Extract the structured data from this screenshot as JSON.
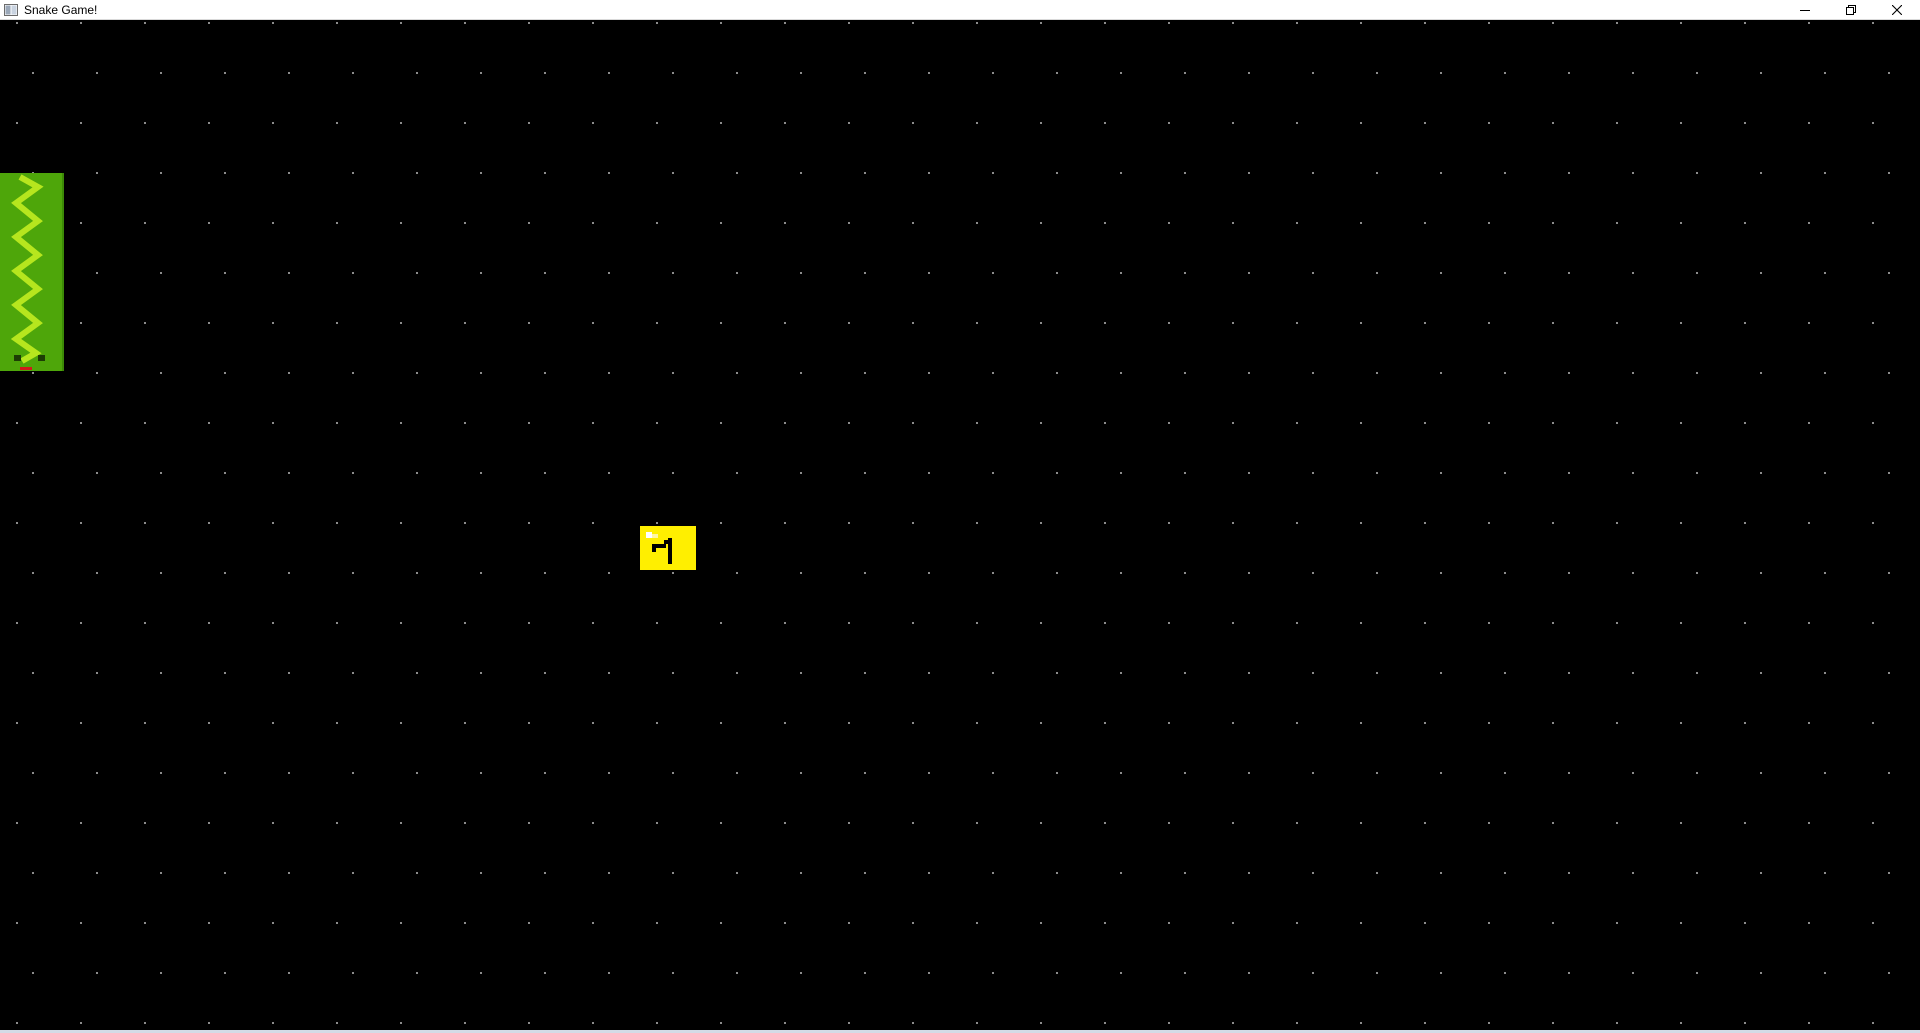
{
  "window": {
    "title": "Snake Game!",
    "icon": "app-window-icon",
    "controls": {
      "minimize_icon": "minimize-icon",
      "maximize_icon": "restore-icon",
      "close_icon": "close-icon"
    }
  },
  "game": {
    "background_color": "#000000",
    "grid_dot_color": "#8c8c8c",
    "snake": {
      "body_color": "#4ea60a",
      "stripe_color": "#b6e61e",
      "eye_color": "#1d3d05",
      "tongue_color": "#d11a1a"
    },
    "food": {
      "color": "#ffef00",
      "glyph_color": "#000000",
      "highlight_color": "#ffffff"
    }
  }
}
